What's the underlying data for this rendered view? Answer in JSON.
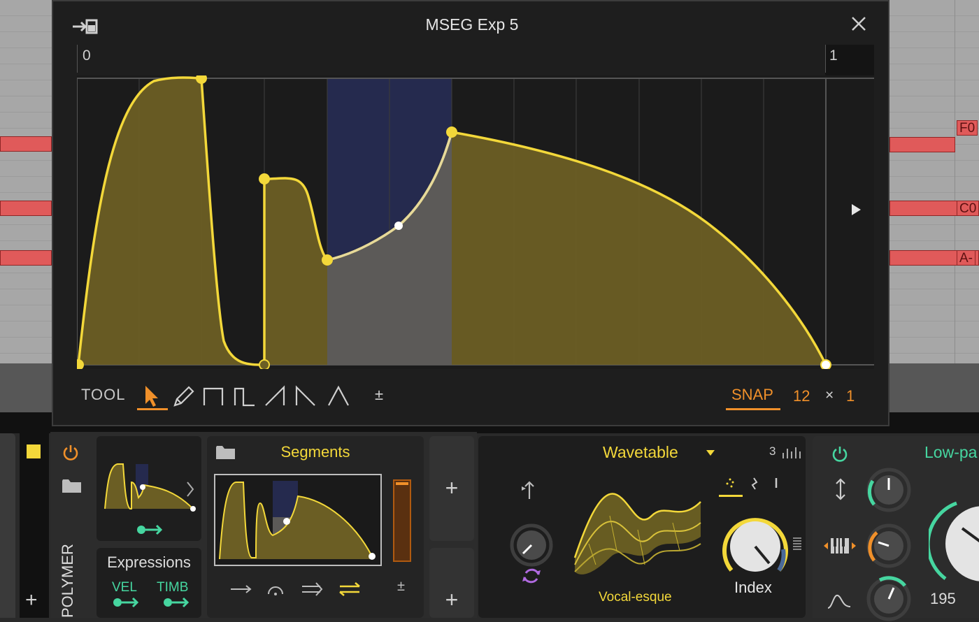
{
  "window": {
    "title": "MSEG Exp 5",
    "ruler_start": "0",
    "ruler_end": "1"
  },
  "piano_roll": {
    "note_labels": [
      "F0",
      "C0",
      "A-"
    ]
  },
  "toolbar": {
    "tool_label": "TOOL",
    "tools": [
      "select-tool",
      "pencil-tool",
      "square-tool",
      "step-tool",
      "ramp-tool",
      "saw-tool",
      "triangle-tool"
    ],
    "active_tool": "select-tool",
    "bipolar_label": "±",
    "snap_label": "SNAP",
    "snap_value": "12",
    "snap_times": "×",
    "snap_multiplier": "1"
  },
  "device": {
    "name": "POLYMER",
    "expressions_title": "Expressions",
    "expr_vel": "VEL",
    "expr_timb": "TIMB",
    "segments_title": "Segments",
    "segments_bipolar": "±"
  },
  "wavetable": {
    "title": "Wavetable",
    "voices": "3",
    "preset": "Vocal-esque",
    "knob_label": "Index"
  },
  "filter": {
    "title": "Low-pa",
    "value": "195"
  },
  "colors": {
    "accent_yellow": "#f3d83a",
    "accent_orange": "#f0902a",
    "accent_green": "#46d6a0",
    "note_red": "#e05a5a",
    "selection_blue": "#252a4e"
  }
}
